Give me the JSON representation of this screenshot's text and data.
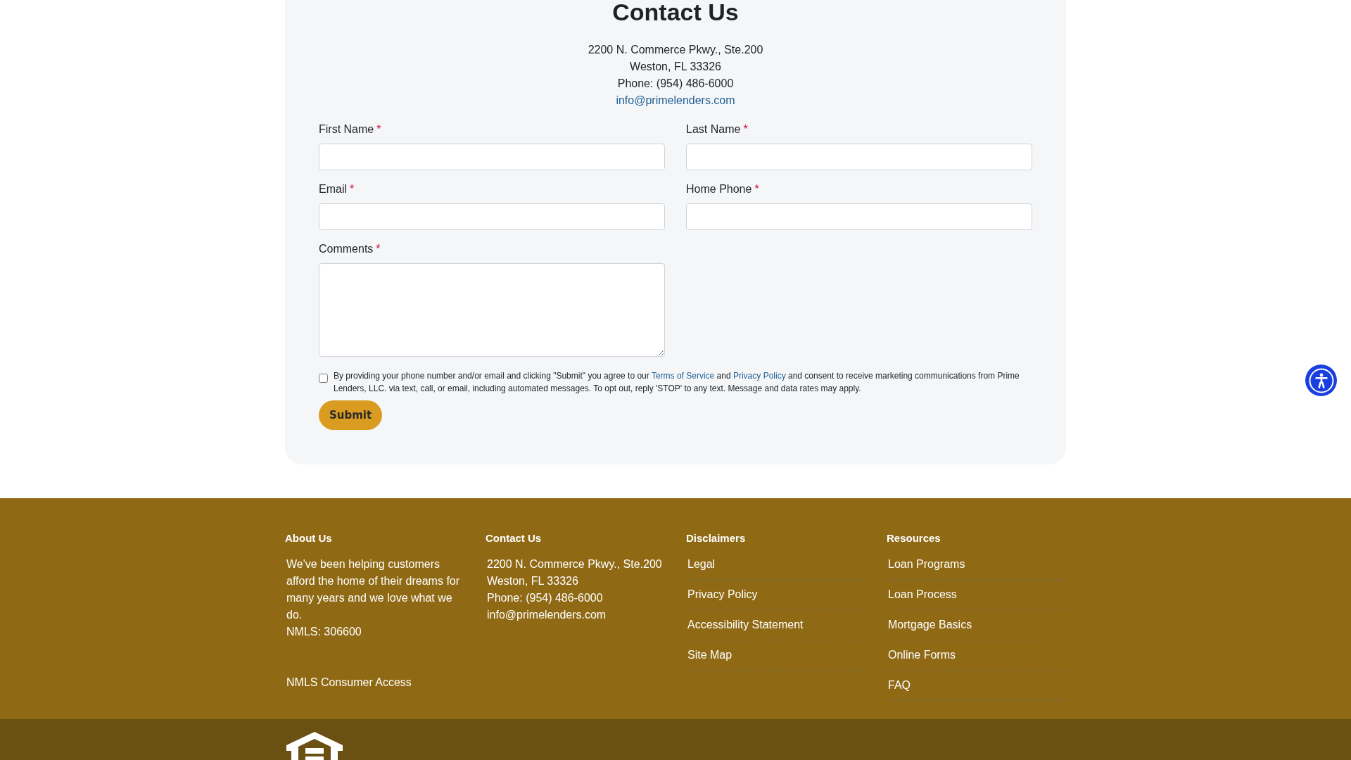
{
  "contact_card": {
    "title": "Contact Us",
    "address_lines": [
      "2200 N. Commerce Pkwy., Ste.200",
      "Weston, FL 33326",
      "Phone: (954) 486-6000"
    ],
    "email_link": "info@primelenders.com"
  },
  "form": {
    "fields": [
      {
        "label": "First Name",
        "required_mark": "*",
        "kind": "input"
      },
      {
        "label": "Last Name",
        "required_mark": "*",
        "kind": "input"
      },
      {
        "label": "Email",
        "required_mark": "*",
        "kind": "input"
      },
      {
        "label": "Home Phone",
        "required_mark": "*",
        "kind": "input"
      },
      {
        "label": "Comments",
        "required_mark": "*",
        "kind": "textarea"
      }
    ],
    "consent": {
      "checked": false,
      "parts": [
        {
          "kind": "text",
          "text": "By providing your phone number and/or email and clicking \"Submit\" you agree to our "
        },
        {
          "kind": "link",
          "text": "Terms of Service"
        },
        {
          "kind": "text",
          "text": " and "
        },
        {
          "kind": "link",
          "text": "Privacy Policy"
        },
        {
          "kind": "text",
          "text": " and consent to receive marketing communications from Prime Lenders, LLC. via text, call, or email, including automated messages. To opt out, reply 'STOP' to any text. Message and data rates may apply."
        }
      ]
    },
    "submit_button": "Submit"
  },
  "footer": {
    "columns": [
      {
        "kind": "about",
        "heading": "About Us",
        "text": "We've been helping customers afford the home of their dreams for many years and we love what we do.",
        "license": "NMLS: 306600",
        "link": "NMLS Consumer Access"
      },
      {
        "kind": "contact",
        "heading": "Contact Us",
        "lines": [
          "2200 N. Commerce Pkwy., Ste.200",
          "Weston, FL 33326",
          "Phone: (954) 486-6000"
        ],
        "email": "info@primelenders.com"
      },
      {
        "kind": "links",
        "heading": "Disclaimers",
        "links": [
          "Legal",
          "Privacy Policy",
          "Accessibility Statement",
          "Site Map"
        ]
      },
      {
        "kind": "links",
        "heading": "Resources",
        "links": [
          "Loan Programs",
          "Loan Process",
          "Mortgage Basics",
          "Online Forms",
          "FAQ"
        ]
      }
    ]
  }
}
